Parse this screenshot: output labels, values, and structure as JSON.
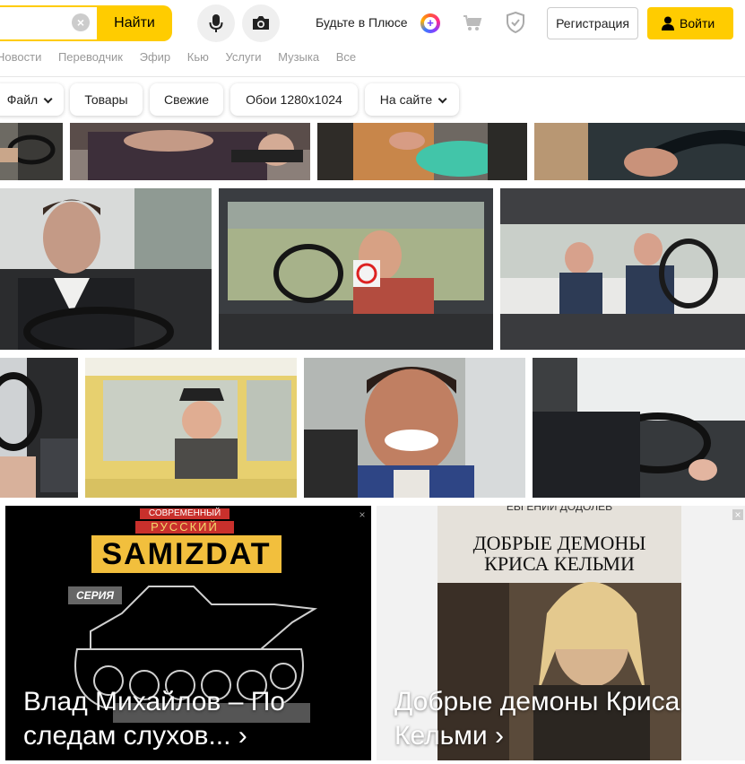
{
  "header": {
    "search_button": "Найти",
    "plus_text": "Будьте в Плюсе",
    "register_button": "Регистрация",
    "login_button": "Войти"
  },
  "services": [
    "Новости",
    "Переводчик",
    "Эфир",
    "Кью",
    "Услуги",
    "Музыка",
    "Все"
  ],
  "filters": [
    "Файл",
    "Товары",
    "Свежие",
    "Обои 1280x1024",
    "На сайте"
  ],
  "ads": [
    {
      "title": "Влад Михайлов – По следам слухов... ›",
      "cover_lines": [
        "СОВРЕМЕННЫЙ",
        "РУССКИЙ",
        "SAMIZDAT",
        "СЕРИЯ"
      ]
    },
    {
      "title": "Добрые демоны Криса Кельми ›",
      "cover_lines": [
        "ЕВГЕНИЙ ДОДОЛЕВ",
        "ДОБРЫЕ ДЕМОНЫ",
        "КРИСА КЕЛЬМИ"
      ]
    }
  ],
  "icons": {
    "clear": "close-icon",
    "voice": "microphone-icon",
    "camera": "camera-icon",
    "plus": "plus-icon",
    "cart": "cart-icon",
    "protect": "shield-icon",
    "user": "user-icon",
    "ad_close": "close-icon"
  },
  "colors": {
    "accent": "#ffcc00"
  }
}
